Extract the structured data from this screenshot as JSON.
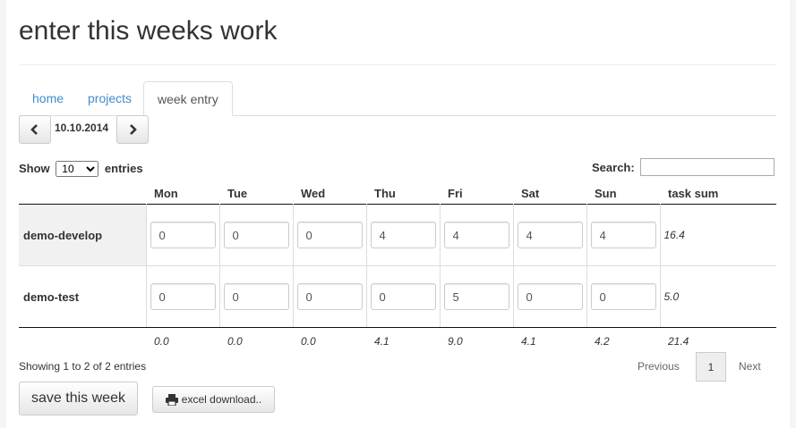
{
  "page": {
    "title": "enter this weeks work"
  },
  "tabs": [
    {
      "label": "home",
      "active": false
    },
    {
      "label": "projects",
      "active": false
    },
    {
      "label": "week entry",
      "active": true
    }
  ],
  "date_nav": {
    "date": "10.10.2014",
    "prev_icon": "chevron-left-icon",
    "next_icon": "chevron-right-icon"
  },
  "length": {
    "show_label": "Show",
    "value": "10",
    "entries_label": "entries"
  },
  "search": {
    "label": "Search:",
    "value": ""
  },
  "table": {
    "columns": [
      "Mon",
      "Tue",
      "Wed",
      "Thu",
      "Fri",
      "Sat",
      "Sun",
      "task sum"
    ],
    "rows": [
      {
        "name": "demo-develop",
        "values": [
          "0",
          "0",
          "0",
          "4",
          "4",
          "4",
          "4"
        ],
        "sum": "16.4"
      },
      {
        "name": "demo-test",
        "values": [
          "0",
          "0",
          "0",
          "0",
          "5",
          "0",
          "0"
        ],
        "sum": "5.0"
      }
    ],
    "totals": [
      "0.0",
      "0.0",
      "0.0",
      "4.1",
      "9.0",
      "4.1",
      "4.2",
      "21.4"
    ]
  },
  "info": "Showing 1 to 2 of 2 entries",
  "pagination": {
    "previous": "Previous",
    "page": "1",
    "next": "Next"
  },
  "actions": {
    "save": "save this week",
    "excel": "excel download..",
    "excel_icon": "printer-icon"
  }
}
